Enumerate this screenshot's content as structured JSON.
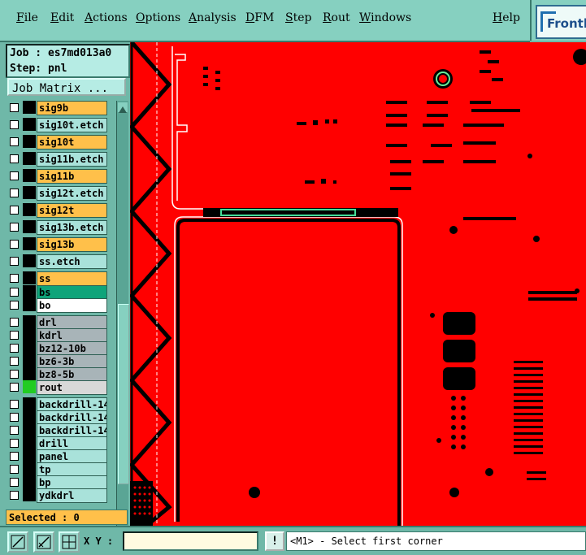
{
  "menu": [
    "File",
    "Edit",
    "Actions",
    "Options",
    "Analysis",
    "DFM",
    "Step",
    "Rout",
    "Windows"
  ],
  "help": "Help",
  "logo": "Frontline",
  "job": {
    "job_line": "Job : es7md013a0",
    "step_line": "Step: pnl"
  },
  "job_matrix_label": "Job Matrix ...",
  "layers": [
    {
      "name": "sig9b",
      "color": "#ffc04a",
      "swatch": "#000000"
    },
    {
      "name": "sig10t.etch",
      "color": "#a9e2da",
      "swatch": "#000000"
    },
    {
      "name": "sig10t",
      "color": "#ffc04a",
      "swatch": "#000000"
    },
    {
      "name": "sig11b.etch",
      "color": "#a9e2da",
      "swatch": "#000000"
    },
    {
      "name": "sig11b",
      "color": "#ffc04a",
      "swatch": "#000000"
    },
    {
      "name": "sig12t.etch",
      "color": "#a9e2da",
      "swatch": "#000000"
    },
    {
      "name": "sig12t",
      "color": "#ffc04a",
      "swatch": "#000000"
    },
    {
      "name": "sig13b.etch",
      "color": "#a9e2da",
      "swatch": "#000000"
    },
    {
      "name": "sig13b",
      "color": "#ffc04a",
      "swatch": "#000000"
    },
    {
      "name": "ss.etch",
      "color": "#a9e2da",
      "swatch": "#000000"
    },
    {
      "name": "ss",
      "color": "#ffc04a",
      "swatch": "#000000"
    },
    {
      "name": "bs",
      "color": "#0fa47a",
      "swatch": "#000000"
    },
    {
      "name": "bo",
      "color": "#ffffff",
      "swatch": "#000000"
    },
    {
      "name": "drl",
      "color": "#a8b4b8",
      "swatch": "#000000"
    },
    {
      "name": "kdrl",
      "color": "#a8b4b8",
      "swatch": "#000000"
    },
    {
      "name": "bz12-10b",
      "color": "#a8b4b8",
      "swatch": "#000000"
    },
    {
      "name": "bz6-3b",
      "color": "#a8b4b8",
      "swatch": "#000000"
    },
    {
      "name": "bz8-5b",
      "color": "#a8b4b8",
      "swatch": "#000000"
    },
    {
      "name": "rout",
      "color": "#d8d8d8",
      "swatch": "#22cc22"
    },
    {
      "name": "backdrill-14",
      "color": "#a9e2da",
      "swatch": "#000000"
    },
    {
      "name": "backdrill-14",
      "color": "#a9e2da",
      "swatch": "#000000"
    },
    {
      "name": "backdrill-14",
      "color": "#a9e2da",
      "swatch": "#000000"
    },
    {
      "name": "drill",
      "color": "#a9e2da",
      "swatch": "#000000"
    },
    {
      "name": "panel",
      "color": "#a9e2da",
      "swatch": "#000000"
    },
    {
      "name": "tp",
      "color": "#a9e2da",
      "swatch": "#000000"
    },
    {
      "name": "bp",
      "color": "#a9e2da",
      "swatch": "#000000"
    },
    {
      "name": "ydkdrl",
      "color": "#a9e2da",
      "swatch": "#000000"
    }
  ],
  "selected_label": "Selected : 0",
  "xy_label": "X Y :",
  "xy_value": "",
  "bang_label": "!",
  "prompt": "<M1> - Select first corner",
  "colors": {
    "canvas": "#ff0000",
    "panel": "#6fb8a8",
    "menubar": "#86d0c0"
  },
  "icons": [
    "zoom-area-icon",
    "measure-icon",
    "grid-icon"
  ]
}
